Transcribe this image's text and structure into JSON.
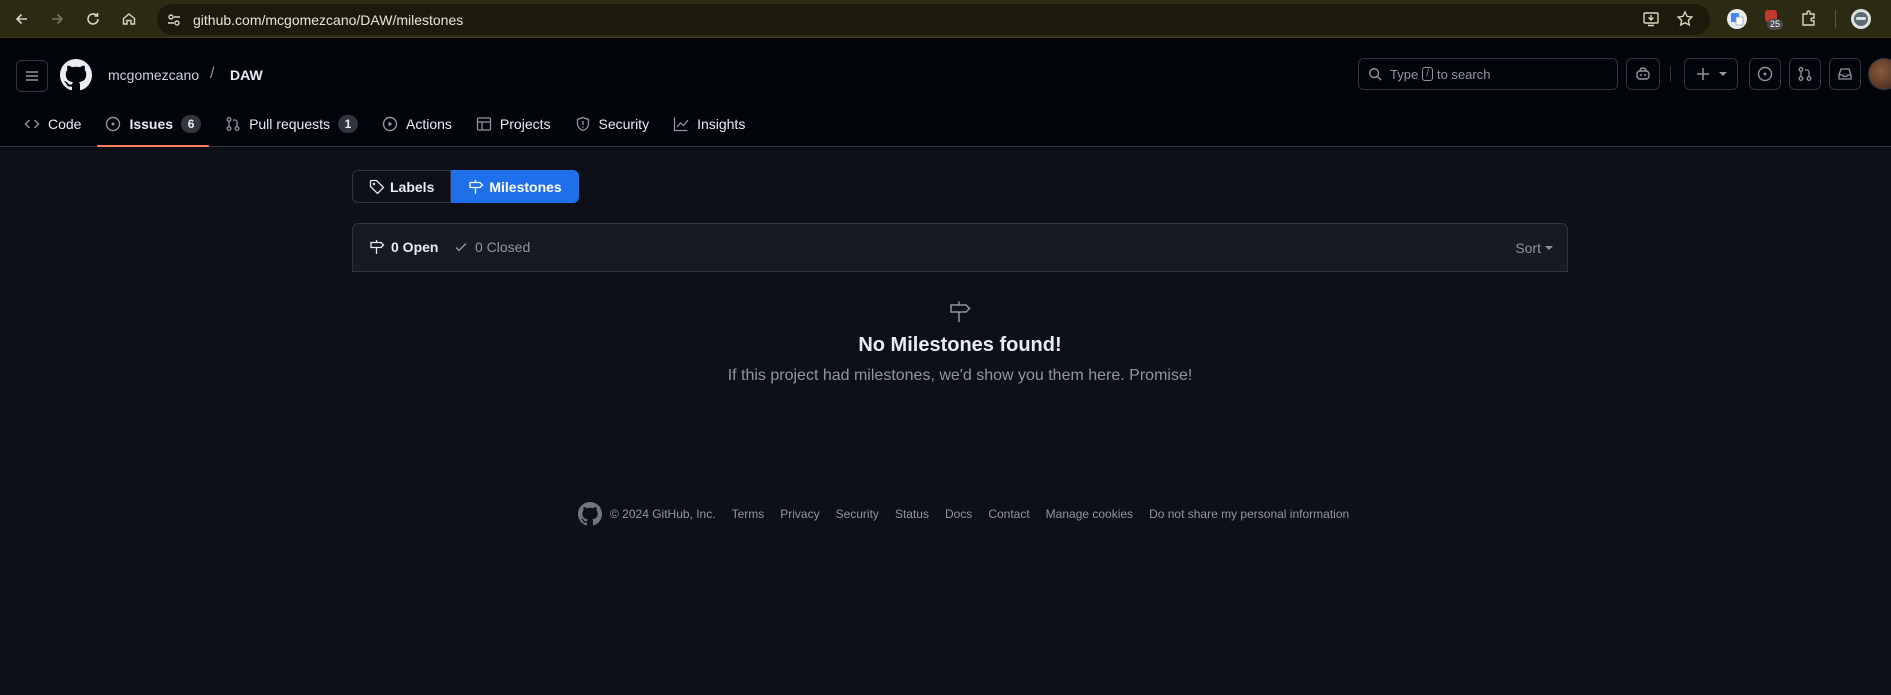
{
  "browser": {
    "url": "github.com/mcgomezcano/DAW/milestones",
    "extension_badge": "25"
  },
  "header": {
    "owner": "mcgomezcano",
    "separator": "/",
    "repo": "DAW",
    "search": {
      "prefix": "Type",
      "key": "/",
      "suffix": "to search"
    }
  },
  "repo_tabs": [
    {
      "label": "Code",
      "icon": "code-icon"
    },
    {
      "label": "Issues",
      "icon": "issue-opened-icon",
      "count": "6",
      "selected": true
    },
    {
      "label": "Pull requests",
      "icon": "git-pull-request-icon",
      "count": "1"
    },
    {
      "label": "Actions",
      "icon": "play-icon"
    },
    {
      "label": "Projects",
      "icon": "table-icon"
    },
    {
      "label": "Security",
      "icon": "shield-icon"
    },
    {
      "label": "Insights",
      "icon": "graph-icon"
    }
  ],
  "subnav": {
    "labels": "Labels",
    "milestones": "Milestones"
  },
  "milestones": {
    "open": "0 Open",
    "closed": "0 Closed",
    "sort": "Sort"
  },
  "blankslate": {
    "title": "No Milestones found!",
    "message": "If this project had milestones, we'd show you them here. Promise!"
  },
  "footer": {
    "copyright": "© 2024 GitHub, Inc.",
    "links": [
      "Terms",
      "Privacy",
      "Security",
      "Status",
      "Docs",
      "Contact",
      "Manage cookies",
      "Do not share my personal information"
    ]
  },
  "colors": {
    "accent": "#1f6feb",
    "tab_underline": "#f78166",
    "background": "#0d1117"
  }
}
